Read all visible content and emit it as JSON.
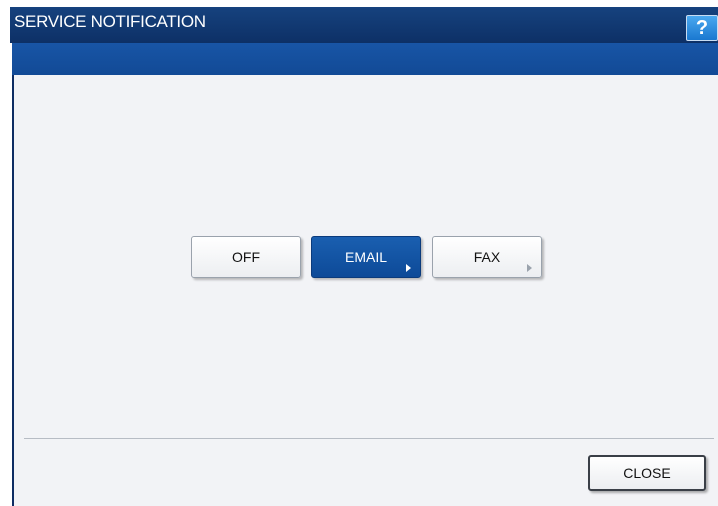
{
  "window": {
    "title": "SERVICE NOTIFICATION",
    "help_label": "?"
  },
  "options": [
    {
      "label": "OFF",
      "selected": false,
      "has_arrow": false
    },
    {
      "label": "EMAIL",
      "selected": true,
      "has_arrow": true
    },
    {
      "label": "FAX",
      "selected": false,
      "has_arrow": true
    }
  ],
  "footer": {
    "close_label": "CLOSE"
  },
  "colors": {
    "title_bar": "#16427e",
    "sub_bar": "#1855a6",
    "selected_button": "#0d4a98",
    "help_button": "#1a78d0",
    "content_background": "#f2f3f6"
  }
}
